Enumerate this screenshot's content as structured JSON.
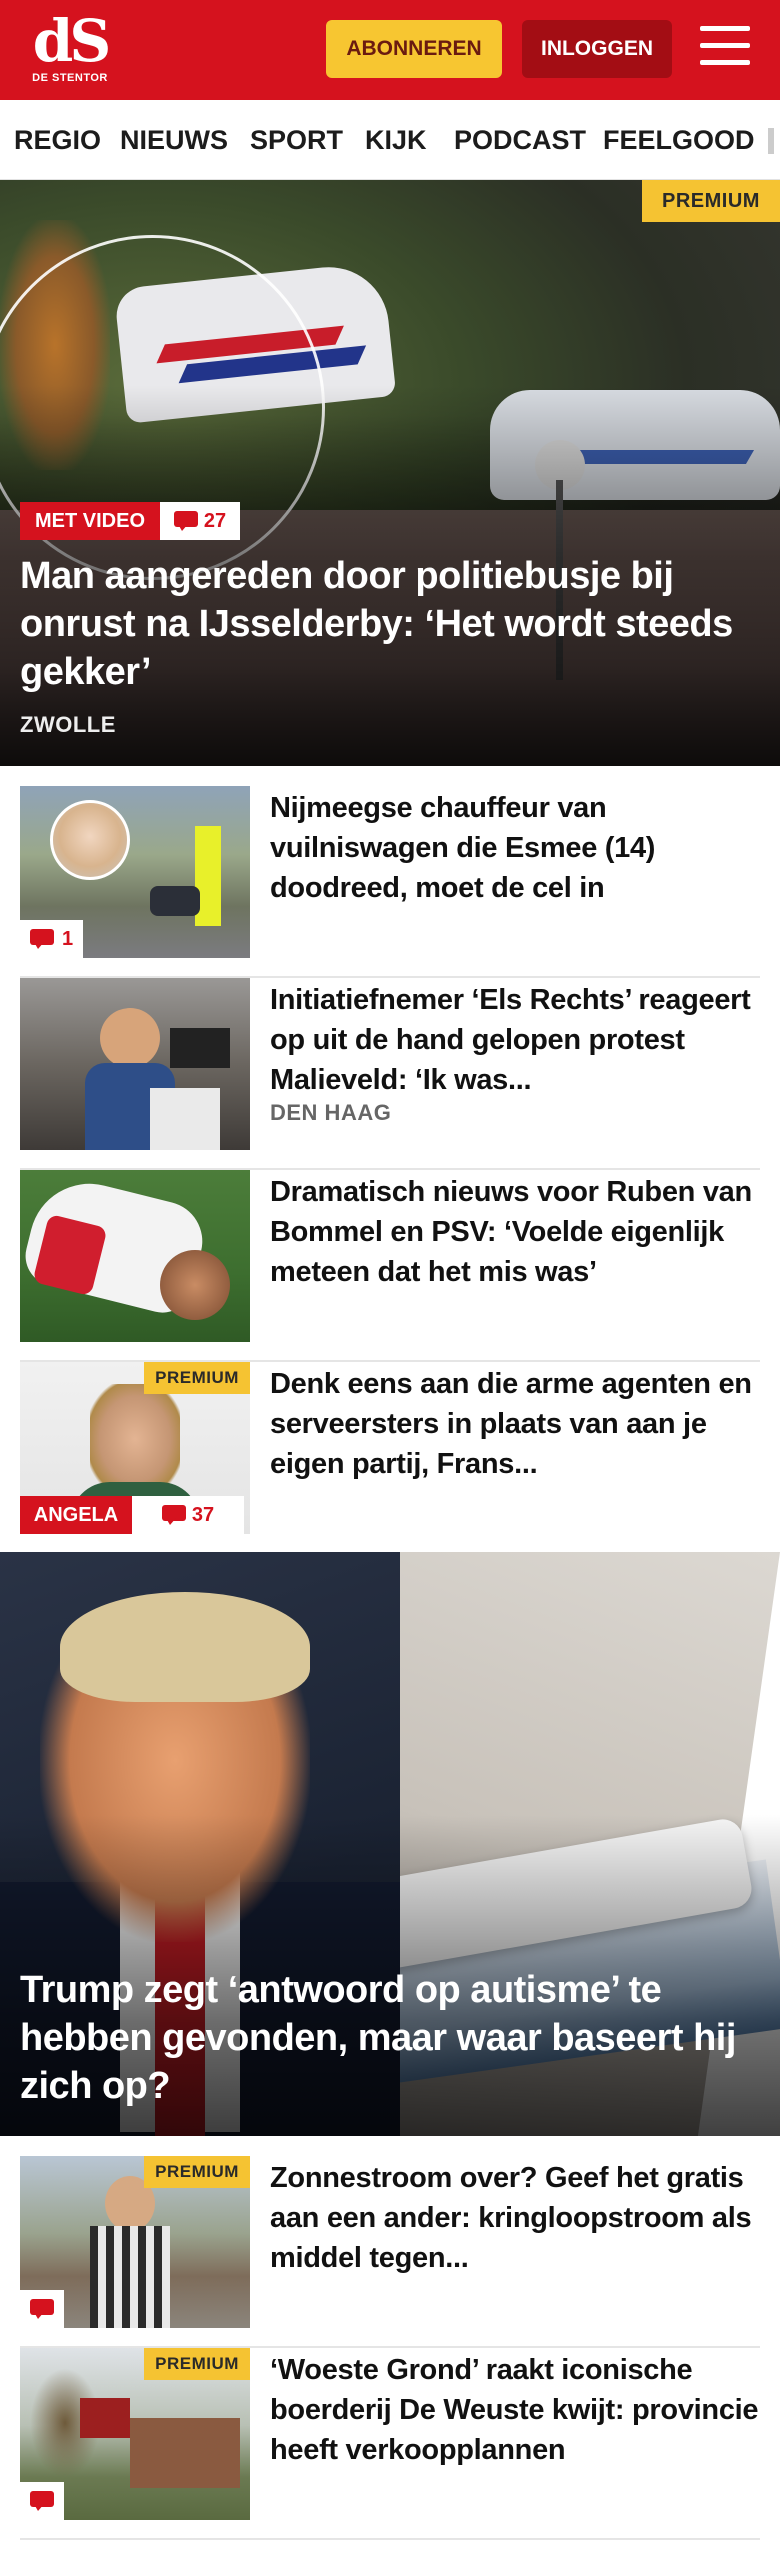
{
  "header": {
    "logo_mark": "dS",
    "logo_sub": "DE STENTOR",
    "subscribe_label": "ABONNEREN",
    "login_label": "INLOGGEN"
  },
  "nav": {
    "items": [
      "REGIO",
      "NIEUWS",
      "SPORT",
      "KIJK",
      "PODCAST",
      "FEELGOOD"
    ]
  },
  "hero": {
    "premium": "PREMIUM",
    "video_tag": "MET VIDEO",
    "comments": "27",
    "title": "Man aangereden door politiebusje bij onrust na IJsselderby: ‘Het wordt steeds gekker’",
    "location": "ZWOLLE"
  },
  "articles": [
    {
      "title": "Nijmeegse chauffeur van vuilniswagen die Esmee (14) doodreed, moet de cel in",
      "comments": "1"
    },
    {
      "title": "Initiatiefnemer ‘Els Rechts’ reageert op uit de hand gelopen protest Malieveld: ‘Ik was...",
      "location": "DEN HAAG"
    },
    {
      "title": "Dramatisch nieuws voor Ruben van Bommel en PSV: ‘Voelde eigenlijk meteen dat het mis was’"
    },
    {
      "title": "Denk eens aan die arme agenten en serveersters in plaats van aan je eigen partij, Frans...",
      "premium": "PREMIUM",
      "author": "ANGELA",
      "comments": "37"
    }
  ],
  "big_story": {
    "title": "Trump zegt ‘antwoord op autisme’ te hebben gevonden, maar waar baseert hij zich op?"
  },
  "articles2": [
    {
      "title": "Zonnestroom over? Geef het gratis aan een ander: kringloop­stroom als middel tegen...",
      "premium": "PREMIUM"
    },
    {
      "title": "‘Woeste Grond’ raakt iconische boerderij De Weuste kwijt: provincie heeft verkoopplannen",
      "premium": "PREMIUM"
    }
  ],
  "colors": {
    "brand_red": "#d5121e",
    "premium_yellow": "#f5c332",
    "subscribe_yellow": "#f7c631",
    "login_dark_red": "#a30d14"
  },
  "icons": {
    "comment": "comment-icon",
    "menu": "hamburger-menu-icon"
  }
}
